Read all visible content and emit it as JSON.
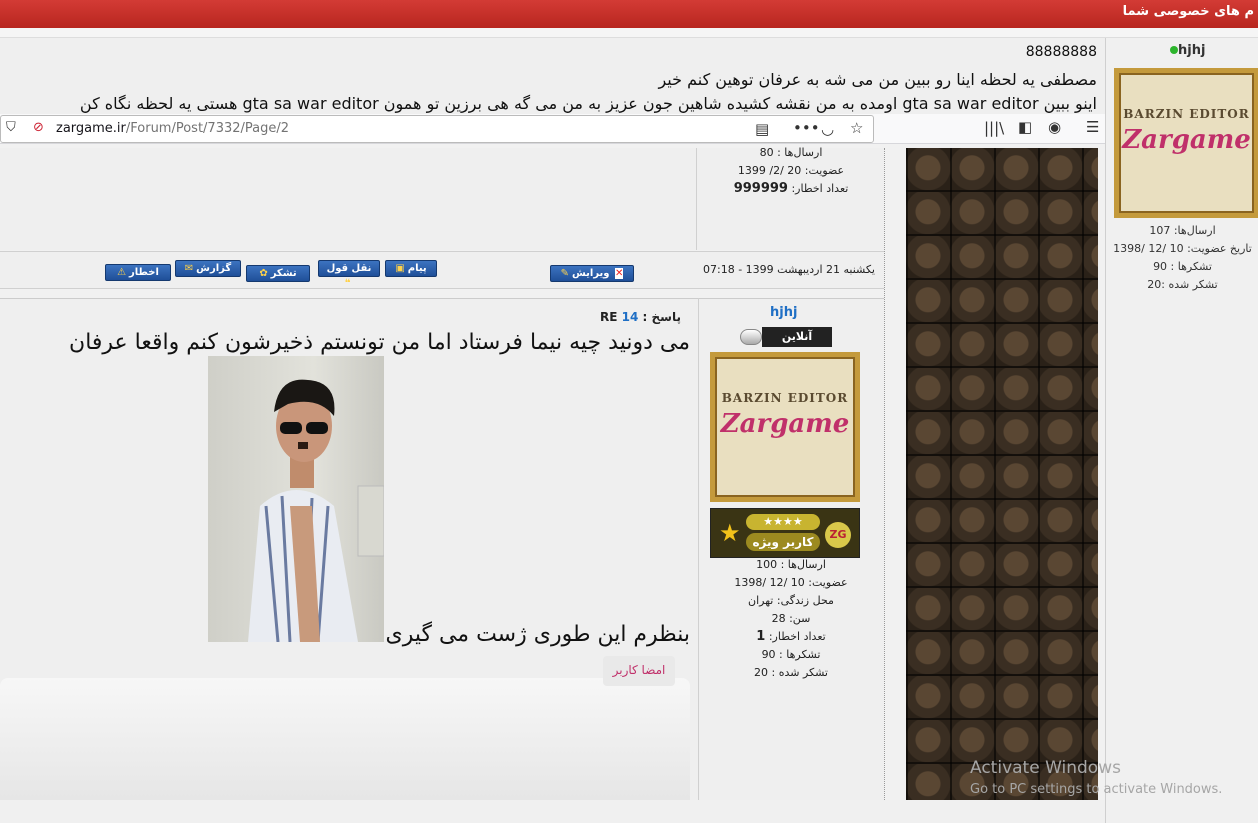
{
  "topbar": {
    "private_messages": "م های خصوصی شما"
  },
  "top_post": {
    "line1": "88888888",
    "line2": "مصطفی یه لحظه اینا رو ببین من می شه به عرفان توهین کنم خیر",
    "line3": "اینو ببین gta sa war editor اومده به من نقشه کشیده شاهین جون عزیز به من می گه هی برزین تو همون gta sa war editor هستی یه لحظه نگاه کن"
  },
  "browser": {
    "url_host": "zargame.ir",
    "url_path": "/Forum/Post/7332/Page/2"
  },
  "right_user": {
    "name": "hjhj",
    "stats": [
      "ارسال‌ها: 107",
      "تاریخ عضویت: 10 /12 /1398",
      "تشکرها : 90",
      "تشکر شده :20"
    ]
  },
  "old_post": {
    "stats": [
      "ارسال‌ها : 80",
      "عضویت: 20 /2/ 1399",
      "تعداد اخطار:"
    ],
    "warnings": "999999",
    "date": "یکشنبه 21 اردیبهشت 1399 - 07:18",
    "buttons": {
      "edit": "ویرایش",
      "message": "پیام",
      "quote": "نقل قول",
      "thanks": "تشکر",
      "report": "گزارش",
      "warn": "اخطار"
    }
  },
  "main_post": {
    "reply_label": "پاسخ :",
    "reply_num": "14",
    "re": "RE",
    "line1": "می دونید چیه نیما فرستاد اما من تونستم ذخیرشون کنم واقعا عرفان",
    "line2": "بنظرم این طوری ژست می گیری",
    "signature_tab": "امضا کاربر"
  },
  "post_user": {
    "name": "hjhj",
    "online": "آنلاین",
    "badge_label": "کاربر ویژه",
    "badge_logo": "ZG",
    "stats": [
      "ارسال‌ها : 100",
      "عضویت: 10 /12 /1398",
      "محل زندگی: تهران",
      "سن: 28",
      "تعداد اخطار:",
      "تشکرها : 90",
      "تشکر شده : 20"
    ],
    "warnings": "1"
  },
  "avatar": {
    "top_text": "BARZIN EDITOR",
    "logo_text": "Zargame"
  },
  "windows": {
    "activate_title": "Activate Windows",
    "activate_sub": "Go to PC settings to activate Windows."
  }
}
